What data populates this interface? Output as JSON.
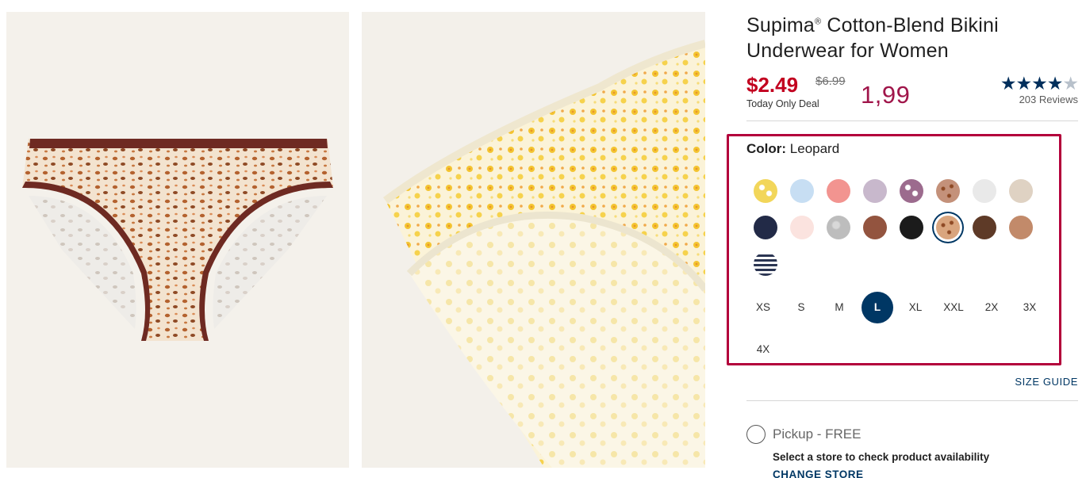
{
  "product": {
    "title_line1": "Supima",
    "title_reg": "®",
    "title_line1_rest": " Cotton-Blend Bikini",
    "title_line2": "Underwear for Women",
    "price_now": "$2.49",
    "price_was": "$6.99",
    "deal_label": "Today Only Deal",
    "annotation": "1,99",
    "rating_stars": "★★★★",
    "rating_half": "★",
    "rating_value": 4.5,
    "reviews": "203 Reviews"
  },
  "color": {
    "label": "Color:",
    "selected_name": "Leopard",
    "swatches": [
      {
        "name": "yellow-floral-swatch",
        "color": "#f2d65a"
      },
      {
        "name": "light-blue-swatch",
        "color": "#c7def3"
      },
      {
        "name": "coral-swatch",
        "color": "#f29490"
      },
      {
        "name": "lavender-swatch",
        "color": "#c8b8cc"
      },
      {
        "name": "purple-floral-swatch",
        "color": "#9c6b8e"
      },
      {
        "name": "brown-print-swatch",
        "color": "#c4917a"
      },
      {
        "name": "light-gray-swatch",
        "color": "#e9e9e9"
      },
      {
        "name": "beige-swatch",
        "color": "#dfd2c3"
      },
      {
        "name": "navy-swatch",
        "color": "#222a47"
      },
      {
        "name": "blush-swatch",
        "color": "#fbe3df"
      },
      {
        "name": "heather-gray-swatch",
        "color": "#bdbdbd"
      },
      {
        "name": "rust-brown-swatch",
        "color": "#93543f"
      },
      {
        "name": "black-swatch",
        "color": "#1b1b1b"
      },
      {
        "name": "leopard-swatch",
        "color": "#d9a57e"
      },
      {
        "name": "chocolate-swatch",
        "color": "#5e3a27"
      },
      {
        "name": "tan-swatch",
        "color": "#c28a6a"
      },
      {
        "name": "navy-stripe-swatch",
        "color": "#2b3552"
      }
    ],
    "selected_index": 13
  },
  "sizes": [
    "XS",
    "S",
    "M",
    "L",
    "XL",
    "XXL",
    "2X",
    "3X",
    "4X"
  ],
  "selected_size": "L",
  "size_guide": "SIZE GUIDE",
  "pickup": {
    "label": "Pickup - FREE",
    "store_message": "Select a store to check product availability",
    "change_store": "CHANGE STORE"
  },
  "colors": {
    "sale_red": "#c2001f",
    "brand_navy": "#003764",
    "annotation_frame": "#b3003b"
  }
}
